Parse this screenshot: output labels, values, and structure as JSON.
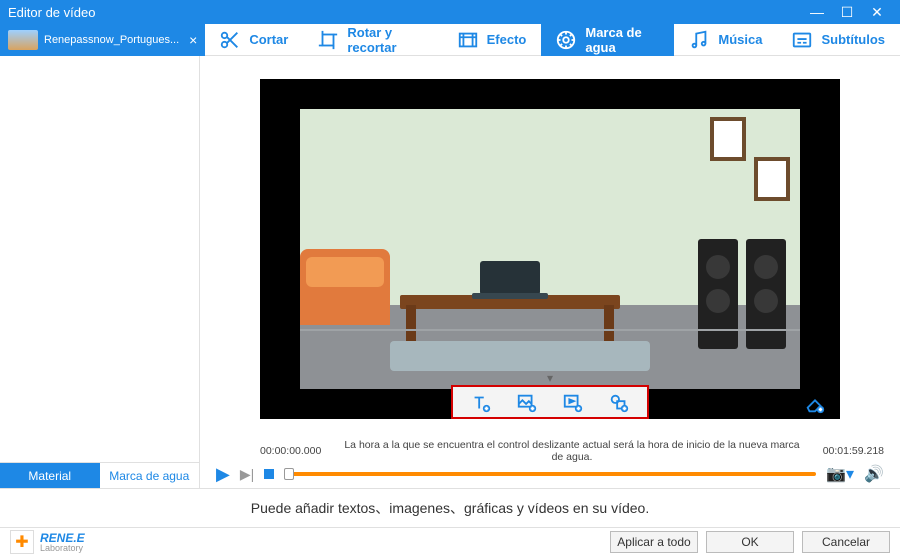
{
  "window": {
    "title": "Editor de vídeo"
  },
  "file_tab": {
    "label": "Renepassnow_Portugues..."
  },
  "tabs": {
    "cut": "Cortar",
    "rotate": "Rotar y recortar",
    "effect": "Efecto",
    "watermark": "Marca de agua",
    "music": "Música",
    "subtitle": "Subtítulos"
  },
  "sidebar_tabs": {
    "material": "Material",
    "watermark": "Marca de agua"
  },
  "timeline": {
    "start": "00:00:00.000",
    "hint": "La hora a la que se encuentra el control deslizante actual será la hora de inicio de la nueva marca de agua.",
    "end": "00:01:59.218"
  },
  "helper": "Puede añadir textos、imagenes、gráficas y vídeos en su vídeo.",
  "brand": {
    "name": "RENE.E",
    "sub": "Laboratory"
  },
  "footer": {
    "apply_all": "Aplicar a todo",
    "ok": "OK",
    "cancel": "Cancelar"
  }
}
